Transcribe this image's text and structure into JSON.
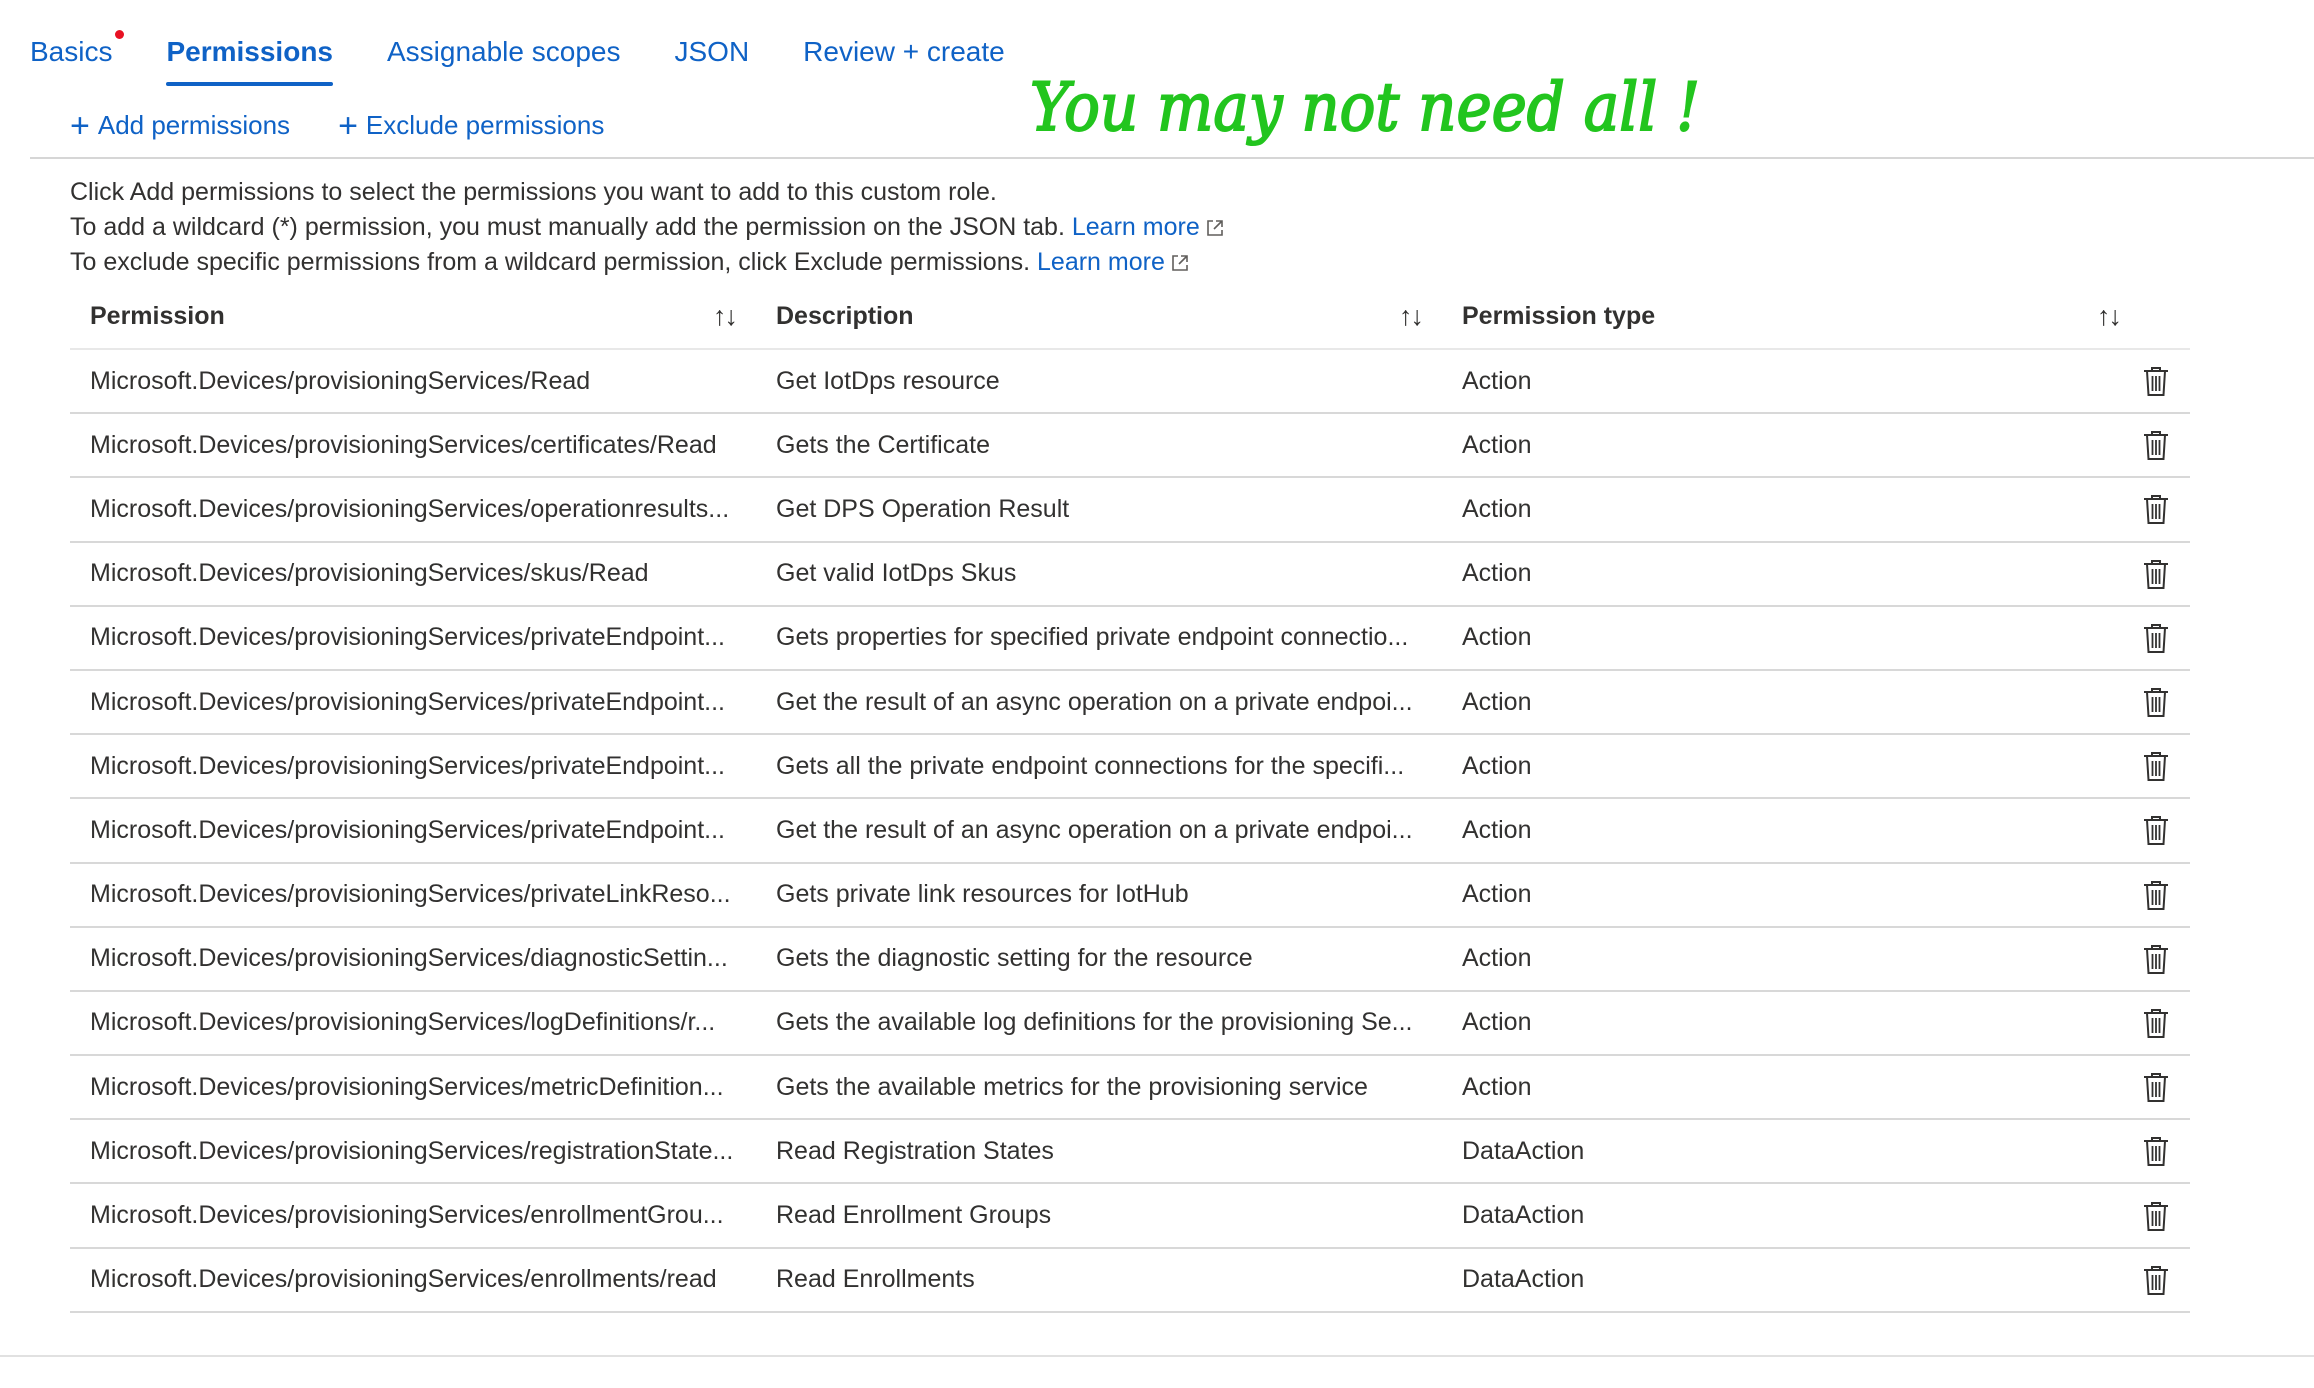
{
  "tabs": [
    {
      "label": "Basics",
      "active": false,
      "error_dot": true
    },
    {
      "label": "Permissions",
      "active": true
    },
    {
      "label": "Assignable scopes",
      "active": false
    },
    {
      "label": "JSON",
      "active": false
    },
    {
      "label": "Review + create",
      "active": false
    }
  ],
  "commands": {
    "add": "Add permissions",
    "exclude": "Exclude permissions"
  },
  "annotation": "You may not need all !",
  "info": {
    "line1": "Click Add permissions to select the permissions you want to add to this custom role.",
    "line2": "To add a wildcard (*) permission, you must manually add the permission on the JSON tab.",
    "line2_link": "Learn more",
    "line3": "To exclude specific permissions from a wildcard permission, click Exclude permissions.",
    "line3_link": "Learn more"
  },
  "table": {
    "headers": [
      "Permission",
      "Description",
      "Permission type"
    ],
    "rows": [
      {
        "permission": "Microsoft.Devices/provisioningServices/Read",
        "description": "Get IotDps resource",
        "type": "Action"
      },
      {
        "permission": "Microsoft.Devices/provisioningServices/certificates/Read",
        "description": "Gets the Certificate",
        "type": "Action"
      },
      {
        "permission": "Microsoft.Devices/provisioningServices/operationresults...",
        "description": "Get DPS Operation Result",
        "type": "Action"
      },
      {
        "permission": "Microsoft.Devices/provisioningServices/skus/Read",
        "description": "Get valid IotDps Skus",
        "type": "Action"
      },
      {
        "permission": "Microsoft.Devices/provisioningServices/privateEndpoint...",
        "description": "Gets properties for specified private endpoint connectio...",
        "type": "Action"
      },
      {
        "permission": "Microsoft.Devices/provisioningServices/privateEndpoint...",
        "description": "Get the result of an async operation on a private endpoi...",
        "type": "Action"
      },
      {
        "permission": "Microsoft.Devices/provisioningServices/privateEndpoint...",
        "description": "Gets all the private endpoint connections for the specifi...",
        "type": "Action"
      },
      {
        "permission": "Microsoft.Devices/provisioningServices/privateEndpoint...",
        "description": "Get the result of an async operation on a private endpoi...",
        "type": "Action"
      },
      {
        "permission": "Microsoft.Devices/provisioningServices/privateLinkReso...",
        "description": "Gets private link resources for IotHub",
        "type": "Action"
      },
      {
        "permission": "Microsoft.Devices/provisioningServices/diagnosticSettin...",
        "description": "Gets the diagnostic setting for the resource",
        "type": "Action"
      },
      {
        "permission": "Microsoft.Devices/provisioningServices/logDefinitions/r...",
        "description": "Gets the available log definitions for the provisioning Se...",
        "type": "Action"
      },
      {
        "permission": "Microsoft.Devices/provisioningServices/metricDefinition...",
        "description": "Gets the available metrics for the provisioning service",
        "type": "Action"
      },
      {
        "permission": "Microsoft.Devices/provisioningServices/registrationState...",
        "description": "Read Registration States",
        "type": "DataAction"
      },
      {
        "permission": "Microsoft.Devices/provisioningServices/enrollmentGrou...",
        "description": "Read Enrollment Groups",
        "type": "DataAction"
      },
      {
        "permission": "Microsoft.Devices/provisioningServices/enrollments/read",
        "description": "Read Enrollments",
        "type": "DataAction"
      }
    ]
  },
  "colors": {
    "accent": "#0f62c6",
    "error": "#e81123",
    "annotation": "#22c51e"
  }
}
